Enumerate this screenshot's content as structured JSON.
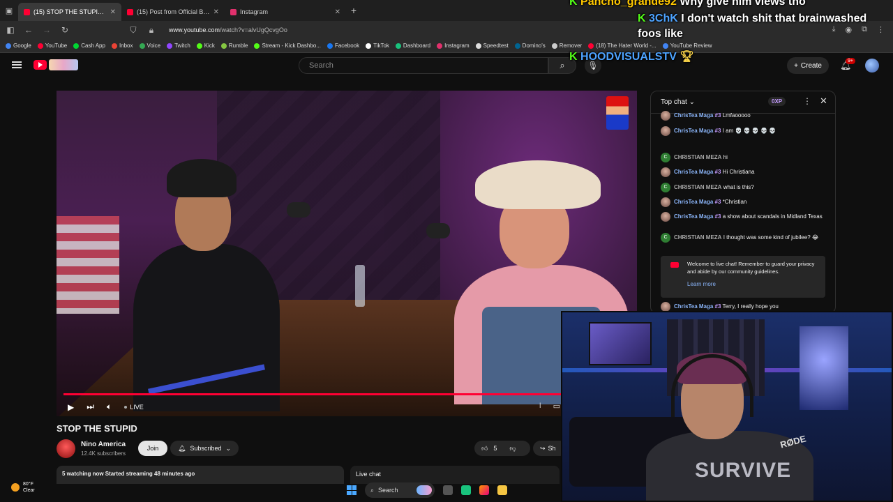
{
  "browser": {
    "tabs": [
      {
        "label": "(15) STOP THE STUPID - YouTube",
        "active": true,
        "color": "#ff0033"
      },
      {
        "label": "(15) Post from Official Blue Dev",
        "active": false,
        "color": "#ff0033"
      },
      {
        "label": "Instagram",
        "active": false,
        "color": "#e1306c"
      }
    ],
    "url_prefix": "www.youtube.com",
    "url_path": "/watch?v=alvUgQcvgOo",
    "bookmarks": [
      {
        "label": "Google",
        "color": "#4285f4"
      },
      {
        "label": "YouTube",
        "color": "#ff0033"
      },
      {
        "label": "Cash App",
        "color": "#00d632"
      },
      {
        "label": "Inbox",
        "color": "#ea4335"
      },
      {
        "label": "Voice",
        "color": "#34a853"
      },
      {
        "label": "Twitch",
        "color": "#9146ff"
      },
      {
        "label": "Kick",
        "color": "#53fc18"
      },
      {
        "label": "Rumble",
        "color": "#85c742"
      },
      {
        "label": "Stream - Kick Dashbo...",
        "color": "#53fc18"
      },
      {
        "label": "Facebook",
        "color": "#1877f2"
      },
      {
        "label": "TikTok",
        "color": "#ffffff"
      },
      {
        "label": "Dashboard",
        "color": "#19c37d"
      },
      {
        "label": "Instagram",
        "color": "#e1306c"
      },
      {
        "label": "Speedtest",
        "color": "#dddddd"
      },
      {
        "label": "Domino's",
        "color": "#006491"
      },
      {
        "label": "Remover",
        "color": "#cccccc"
      },
      {
        "label": "(18) The Hater World -...",
        "color": "#ff0033"
      },
      {
        "label": "YouTube Review",
        "color": "#4285f4"
      }
    ]
  },
  "overlay_chat": [
    {
      "name": "Pancho_grande92",
      "text": "Why give him views tho"
    },
    {
      "name": "3ChK",
      "text": "I don't watch shit that brainwashed foos like"
    },
    {
      "name": "HOODVISUALSTV",
      "text": ""
    }
  ],
  "youtube": {
    "search_placeholder": "Search",
    "create_label": "Create",
    "notif_count": "9+"
  },
  "player": {
    "live_label": "LIVE"
  },
  "video": {
    "title": "STOP THE STUPID",
    "channel": "Nino America",
    "subscribers": "12.4K subscribers",
    "join_label": "Join",
    "subscribed_label": "Subscribed",
    "likes": "5",
    "share_label": "Sh",
    "stats": "5 watching now  Started streaming 48 minutes ago",
    "live_chat_label": "Live chat"
  },
  "chat": {
    "header": "Top chat",
    "xp": "0XP",
    "messages": [
      {
        "author": "ChrisTea Maga",
        "badge": "#3",
        "text": "Lmfaooooo",
        "kind": "photo"
      },
      {
        "author": "ChrisTea Maga",
        "badge": "#3",
        "text": "I am 💀 💀 💀 💀 💀",
        "kind": "photo"
      },
      {
        "author": "CHRISTIAN MEZA",
        "badge": "",
        "text": "hi",
        "kind": "c"
      },
      {
        "author": "ChrisTea Maga",
        "badge": "#3",
        "text": "Hi Christiana",
        "kind": "photo"
      },
      {
        "author": "CHRISTIAN MEZA",
        "badge": "",
        "text": "what is this?",
        "kind": "c"
      },
      {
        "author": "ChrisTea Maga",
        "badge": "#3",
        "text": "*Christian",
        "kind": "photo"
      },
      {
        "author": "ChrisTea Maga",
        "badge": "#3",
        "text": "a show about scandals in Midland Texas",
        "kind": "photo"
      },
      {
        "author": "CHRISTIAN MEZA",
        "badge": "",
        "text": "I thought was some kind of jubilee? 😂",
        "kind": "c"
      }
    ],
    "welcome_text": "Welcome to live chat! Remember to guard your privacy and abide by our community guidelines.",
    "learn_more": "Learn more",
    "last_message": {
      "author": "ChrisTea Maga",
      "badge": "#3",
      "text": "Terry, I really hope you"
    }
  },
  "webcam": {
    "shirt_text": "SURVIVE",
    "mic_text": "RØDE"
  },
  "taskbar": {
    "temperature": "80°F",
    "condition": "Clear",
    "search_label": "Search"
  }
}
